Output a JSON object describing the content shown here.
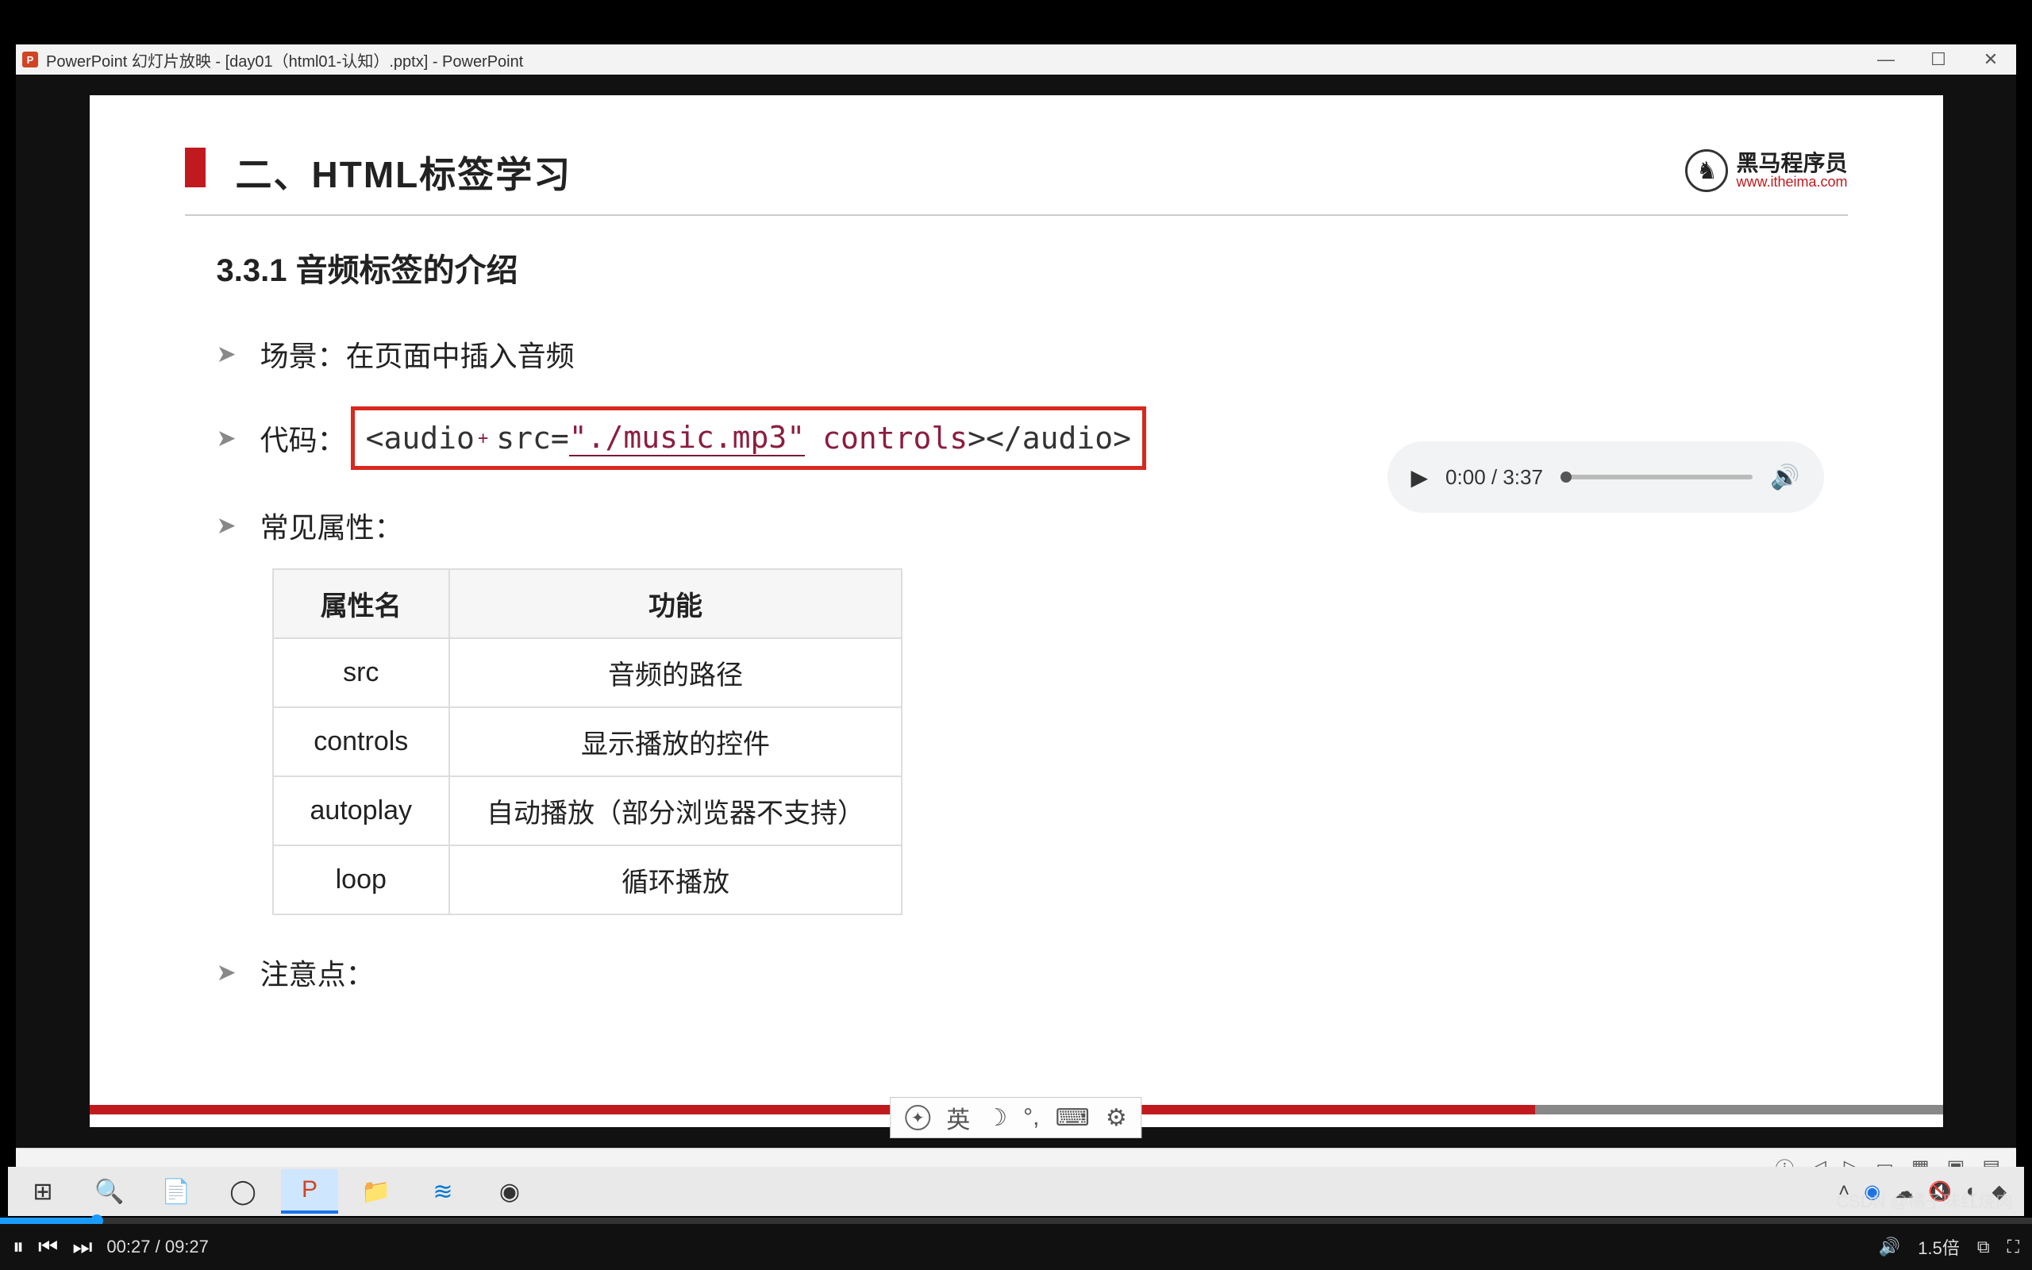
{
  "window": {
    "title": "PowerPoint 幻灯片放映 - [day01（html01-认知）.pptx] - PowerPoint"
  },
  "logo": {
    "name": "黑马程序员",
    "url": "www.itheima.com"
  },
  "slide": {
    "title": "二、HTML标签学习",
    "subtitle": "3.3.1 音频标签的介绍",
    "bullets": {
      "scene_label": "场景：",
      "scene_value": "在页面中插入音频",
      "code_label": "代码：",
      "attrs_label": "常见属性：",
      "note_label": "注意点："
    },
    "code": {
      "open": "<audio",
      "src_attr": "src=",
      "src_val": "\"./music.mp3\"",
      "controls": "controls",
      "close": "></audio>"
    },
    "table": {
      "headers": [
        "属性名",
        "功能"
      ],
      "rows": [
        [
          "src",
          "音频的路径"
        ],
        [
          "controls",
          "显示播放的控件"
        ],
        [
          "autoplay",
          "自动播放（部分浏览器不支持）"
        ],
        [
          "loop",
          "循环播放"
        ]
      ]
    }
  },
  "audio_player": {
    "time": "0:00 / 3:37"
  },
  "ime": {
    "lang": "英"
  },
  "video": {
    "current": "00:27",
    "total": "09:27",
    "speed": "1.5倍"
  },
  "watermark": "CSDN @橘子味红烧肉"
}
